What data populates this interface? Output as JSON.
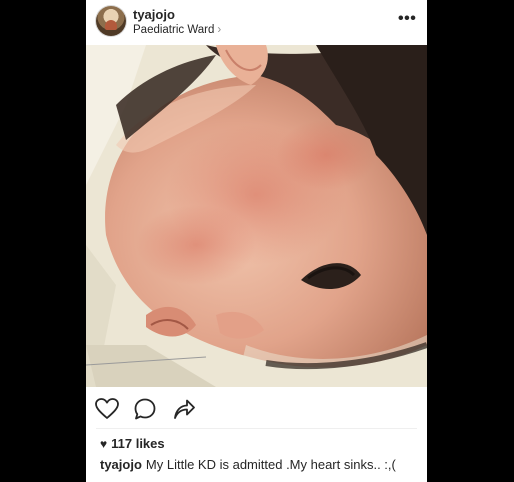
{
  "post": {
    "username": "tyajojo",
    "location": "Paediatric Ward",
    "location_chevron": "›",
    "more_glyph": "•••",
    "image_alt": "Photo of a sleeping child with a red rash on the forehead and face",
    "likes_label": "117 likes",
    "caption_user": "tyajojo",
    "caption_text": "My Little KD is admitted .My heart sinks.. :,("
  },
  "icons": {
    "like": "heart-outline-icon",
    "comment": "speech-bubble-icon",
    "share": "share-arrow-icon",
    "likes": "heart-filled-icon"
  },
  "colors": {
    "background": "#000000",
    "card": "#ffffff",
    "text": "#262626",
    "muted": "#8e8e8e"
  }
}
